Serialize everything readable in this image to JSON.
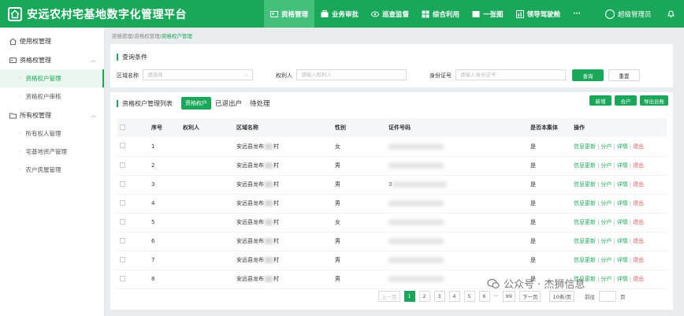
{
  "app": {
    "title": "安远农村宅基地数字化管理平台"
  },
  "nav": {
    "items": [
      {
        "label": "资格管理",
        "icon": "user-card-icon",
        "active": true
      },
      {
        "label": "业务审批",
        "icon": "briefcase-icon",
        "active": false
      },
      {
        "label": "巡查监督",
        "icon": "eye-icon",
        "active": false
      },
      {
        "label": "综合利用",
        "icon": "grid-icon",
        "active": false
      },
      {
        "label": "一张图",
        "icon": "map-icon",
        "active": false
      },
      {
        "label": "领导驾驶舱",
        "icon": "dashboard-icon",
        "active": false
      }
    ],
    "more": "···"
  },
  "user": {
    "name": "超级管理员"
  },
  "sidebar": {
    "groups": [
      {
        "label": "使用权管理",
        "icon": "house-icon",
        "expanded": false,
        "items": []
      },
      {
        "label": "资格权管理",
        "icon": "id-card-icon",
        "expanded": true,
        "items": [
          {
            "label": "资格权户管理",
            "active": true
          },
          {
            "label": "资格权户审核",
            "active": false
          }
        ]
      },
      {
        "label": "所有权管理",
        "icon": "folder-icon",
        "expanded": true,
        "items": [
          {
            "label": "所有权人管理",
            "active": false
          },
          {
            "label": "宅基地资产管理",
            "active": false
          },
          {
            "label": "农户房屋管理",
            "active": false
          }
        ]
      }
    ]
  },
  "breadcrumb": {
    "part1": "资格管理",
    "part2": "资格权管理",
    "current": "资格权户管理",
    "sep": "/"
  },
  "query": {
    "title": "查询条件",
    "region_label": "区域名称",
    "region_placeholder": "请选择",
    "holder_label": "权利人",
    "holder_placeholder": "请输入权利人",
    "idcard_label": "身份证号",
    "idcard_placeholder": "请输入身份证号",
    "search_button": "查询",
    "reset_button": "重置"
  },
  "list": {
    "title": "资格权户管理列表",
    "tabs": [
      {
        "label": "资格权户",
        "active": true
      },
      {
        "label": "已退出户",
        "active": false
      },
      {
        "label": "待处理",
        "active": false
      }
    ],
    "buttons": {
      "add": "新增",
      "split": "合户",
      "export": "导出台账"
    },
    "columns": [
      "序号",
      "权利人",
      "区域名称",
      "性别",
      "证件号码",
      "是否本集体",
      "操作"
    ],
    "rows": [
      {
        "no": "1",
        "region_prefix": "安远县龙布",
        "region_suffix": "村",
        "gender": "女",
        "id_shown": "",
        "collective": "是"
      },
      {
        "no": "2",
        "region_prefix": "安远县龙布",
        "region_suffix": "村",
        "gender": "男",
        "id_shown": "",
        "collective": "是"
      },
      {
        "no": "3",
        "region_prefix": "安远县龙布",
        "region_suffix": "村",
        "gender": "男",
        "id_shown": "3",
        "collective": "是"
      },
      {
        "no": "4",
        "region_prefix": "安远县龙布",
        "region_suffix": "村",
        "gender": "男",
        "id_shown": "",
        "collective": "是"
      },
      {
        "no": "5",
        "region_prefix": "安远县龙布",
        "region_suffix": "村",
        "gender": "女",
        "id_shown": "",
        "collective": "是"
      },
      {
        "no": "6",
        "region_prefix": "安远县龙布",
        "region_suffix": "村",
        "gender": "男",
        "id_shown": "",
        "collective": "是"
      },
      {
        "no": "7",
        "region_prefix": "安远县龙布",
        "region_suffix": "村",
        "gender": "男",
        "id_shown": "",
        "collective": "是"
      },
      {
        "no": "8",
        "region_prefix": "安远县龙布",
        "region_suffix": "村",
        "gender": "男",
        "id_shown": "",
        "collective": "是"
      }
    ],
    "actions": {
      "update": "信息更新",
      "split": "分户",
      "detail": "详情",
      "exit": "退出",
      "sep": "|"
    }
  },
  "pagination": {
    "prev": "上一页",
    "pages": [
      "1",
      "2",
      "3",
      "4",
      "5",
      "6"
    ],
    "ellipsis": "···",
    "last": "99",
    "next": "下一页",
    "page_size": "10条/页",
    "goto": "前往",
    "page_unit": "页",
    "current": "1"
  },
  "watermark": {
    "text": "公众号 · 杰狮信息"
  },
  "colors": {
    "brand": "#1aa75a",
    "nav_active": "#43c07a",
    "danger": "#e25656"
  }
}
